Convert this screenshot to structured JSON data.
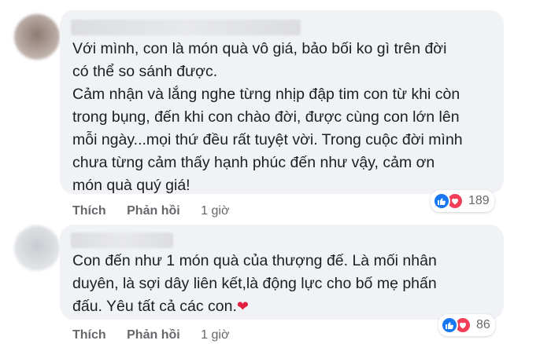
{
  "comments": [
    {
      "text": "Với mình, con là món quà vô giá, bảo bối ko gì trên đời\ncó thể so sánh được.\nCảm nhận và lắng nghe từng nhịp đập tim con từ khi còn\ntrong bụng, đến khi con chào đời, được cùng con lớn lên\nmỗi ngày...mọi thứ đều rất tuyệt vời. Trong cuộc đời mình\nchưa từng cảm thấy hạnh phúc đến như vậy, cảm ơn\nmón quà quý giá!",
      "reaction_count": "189",
      "like_label": "Thích",
      "reply_label": "Phản hồi",
      "time": "1 giờ"
    },
    {
      "text": "Con đến như 1 món quà của thượng đế. Là mối nhân\nduyên, là sợi dây liên kết,là động lực cho bố mẹ phấn\nđấu. Yêu tất cả các con.",
      "emoji": "❤",
      "reaction_count": "86",
      "like_label": "Thích",
      "reply_label": "Phản hồi",
      "time": "1 giờ"
    }
  ],
  "icons": {
    "like": "like-reaction-icon",
    "love": "love-reaction-icon"
  },
  "colors": {
    "bubble": "#f0f2f5",
    "like": "#1877f2",
    "love": "#f33e58",
    "meta_text": "#65676b"
  }
}
